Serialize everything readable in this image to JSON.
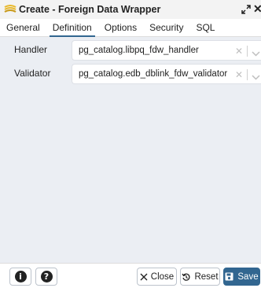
{
  "window": {
    "title": "Create - Foreign Data Wrapper"
  },
  "tabs": [
    {
      "label": "General",
      "active": false
    },
    {
      "label": "Definition",
      "active": true
    },
    {
      "label": "Options",
      "active": false
    },
    {
      "label": "Security",
      "active": false
    },
    {
      "label": "SQL",
      "active": false
    }
  ],
  "fields": {
    "handler": {
      "label": "Handler",
      "value": "pg_catalog.libpq_fdw_handler"
    },
    "validator": {
      "label": "Validator",
      "value": "pg_catalog.edb_dblink_fdw_validator"
    }
  },
  "footer": {
    "info_icon": "i",
    "help_icon": "?",
    "close_label": "Close",
    "reset_label": "Reset",
    "save_label": "Save"
  },
  "icons": {
    "title": "foreign-data-wrapper-icon",
    "expand": "expand-icon",
    "close": "close-icon",
    "clear": "clear-icon",
    "dropdown": "chevron-down-icon"
  },
  "colors": {
    "accent": "#326690",
    "content_background": "#ebeef3",
    "title_icon": "#e8b92e"
  }
}
